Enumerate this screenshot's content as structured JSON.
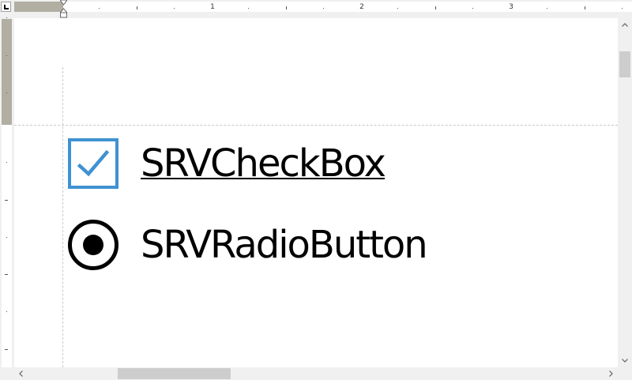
{
  "ruler": {
    "numbers": [
      "1",
      "2",
      "3"
    ]
  },
  "controls": {
    "checkbox": {
      "label": "SRVCheckBox",
      "checked": true,
      "icon": "checkmark-icon"
    },
    "radio": {
      "label": "SRVRadioButton",
      "selected": true,
      "icon": "radio-dot-icon"
    }
  },
  "colors": {
    "checkbox_accent": "#3f92d2",
    "ruler_margin": "#b1aea2",
    "scroll_thumb": "#cdcdcd"
  },
  "scrollbars": {
    "up_icon": "arrow-up-icon",
    "down_icon": "arrow-down-icon",
    "left_icon": "arrow-left-icon",
    "right_icon": "arrow-right-icon"
  }
}
